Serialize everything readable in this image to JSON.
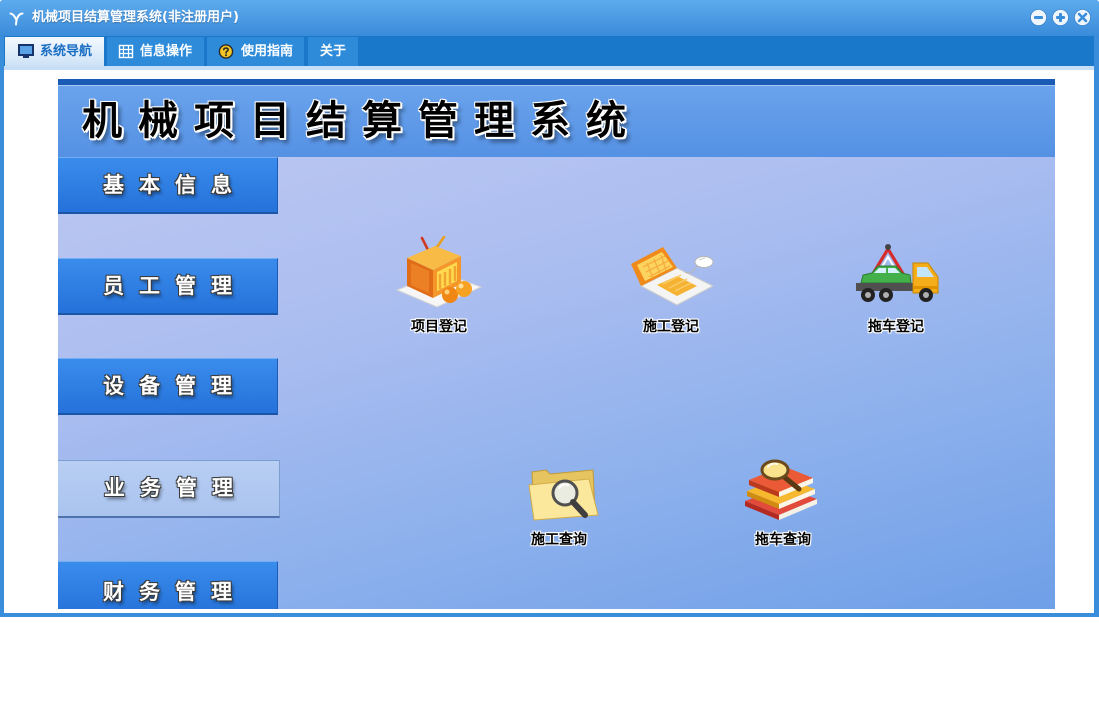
{
  "window": {
    "title": "机械项目结算管理系统(非注册用户)",
    "logo_icon": "app-logo-icon",
    "controls": [
      "minimize-icon",
      "maximize-icon",
      "close-icon"
    ]
  },
  "tabs": [
    {
      "label": "系统导航",
      "icon": "monitor-icon",
      "selected": true
    },
    {
      "label": "信息操作",
      "icon": "grid-icon",
      "selected": false
    },
    {
      "label": "使用指南",
      "icon": "help-icon",
      "selected": false
    },
    {
      "label": "关于",
      "selected": false
    }
  ],
  "header": {
    "title": "机械项目结算管理系统"
  },
  "sidebar": {
    "items": [
      {
        "label": "基本信息",
        "selected": false
      },
      {
        "label": "员工管理",
        "selected": false
      },
      {
        "label": "设备管理",
        "selected": false
      },
      {
        "label": "业务管理",
        "selected": true
      },
      {
        "label": "财务管理",
        "selected": false
      }
    ]
  },
  "launchers": [
    {
      "label": "项目登记",
      "icon": "tv-icon"
    },
    {
      "label": "施工登记",
      "icon": "laptop-icon"
    },
    {
      "label": "拖车登记",
      "icon": "tow-truck-icon"
    },
    {
      "label": "施工查询",
      "icon": "folder-search-icon"
    },
    {
      "label": "拖车查询",
      "icon": "books-search-icon"
    }
  ],
  "colors": {
    "title_bar_top": "#5eabee",
    "title_bar_bottom": "#3a8bd9",
    "tab_bar": "#1a78cb",
    "tab": "#2d8bda",
    "tab_selected_text": "#1a6fc4",
    "nav_button": "#3a8cec",
    "nav_button_dark": "#2572da",
    "nav_selected": "#aac4ef",
    "header_band": "#5591e4",
    "body_top": "#bcc7f2",
    "body_bottom": "#6f9fe8"
  }
}
